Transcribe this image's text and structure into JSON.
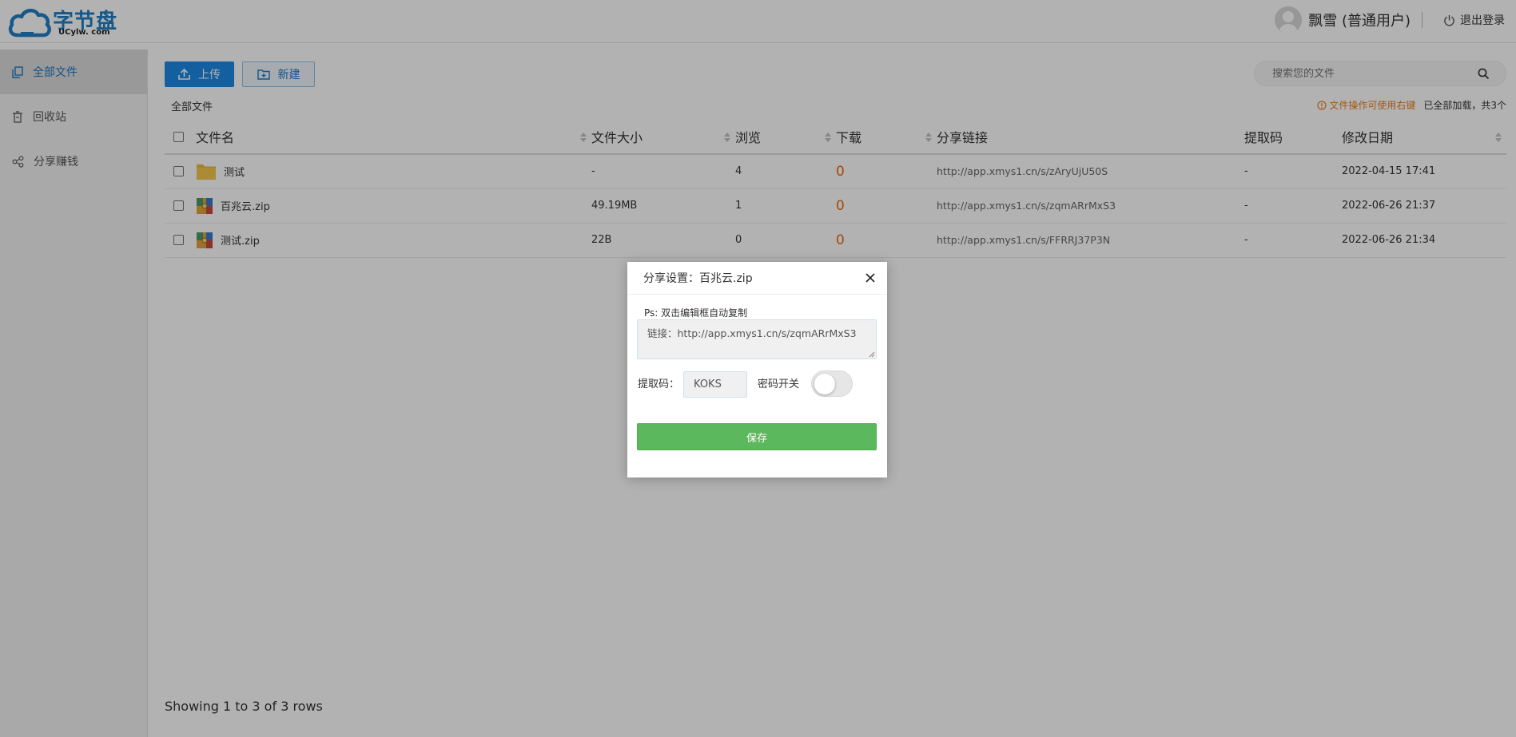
{
  "app": {
    "logo_text": "字节盘",
    "logo_sub": "UCylw. com",
    "user_name": "飘雪 (普通用户)",
    "logout_label": "退出登录"
  },
  "sidebar": {
    "items": [
      {
        "label": "全部文件",
        "icon": "files-icon",
        "active": true
      },
      {
        "label": "回收站",
        "icon": "trash-icon",
        "active": false
      },
      {
        "label": "分享赚钱",
        "icon": "share-icon",
        "active": false
      }
    ]
  },
  "toolbar": {
    "upload_label": "上传",
    "new_label": "新建",
    "search_placeholder": "搜索您的文件"
  },
  "breadcrumb": "全部文件",
  "tip": {
    "hint": "文件操作可使用右键",
    "count": "已全部加载，共3个"
  },
  "table": {
    "headers": [
      "文件名",
      "文件大小",
      "浏览",
      "下载",
      "分享链接",
      "提取码",
      "修改日期"
    ],
    "rows": [
      {
        "name": "测试",
        "type": "folder",
        "size": "-",
        "views": "4",
        "downloads": "0",
        "link": "http://app.xmys1.cn/s/zAryUjU50S",
        "code": "-",
        "date": "2022-04-15 17:41"
      },
      {
        "name": "百兆云.zip",
        "type": "zip",
        "size": "49.19MB",
        "views": "1",
        "downloads": "0",
        "link": "http://app.xmys1.cn/s/zqmARrMxS3",
        "code": "-",
        "date": "2022-06-26 21:37"
      },
      {
        "name": "测试.zip",
        "type": "zip",
        "size": "22B",
        "views": "0",
        "downloads": "0",
        "link": "http://app.xmys1.cn/s/FFRRJ37P3N",
        "code": "-",
        "date": "2022-06-26 21:34"
      }
    ]
  },
  "footer": "Showing 1 to 3 of 3 rows",
  "modal": {
    "title": "分享设置：百兆云.zip",
    "ps_note": "Ps: 双击编辑框自动复制",
    "link_value": "链接：http://app.xmys1.cn/s/zqmARrMxS3",
    "code_label": "提取码：",
    "code_value": "KOKS",
    "password_switch_label": "密码开关",
    "password_switch_on": false,
    "save_label": "保存"
  },
  "colors": {
    "primary": "#1e88e5",
    "download_count": "#ee6a0c",
    "tip": "#e8801a",
    "save": "#5cb85c"
  }
}
